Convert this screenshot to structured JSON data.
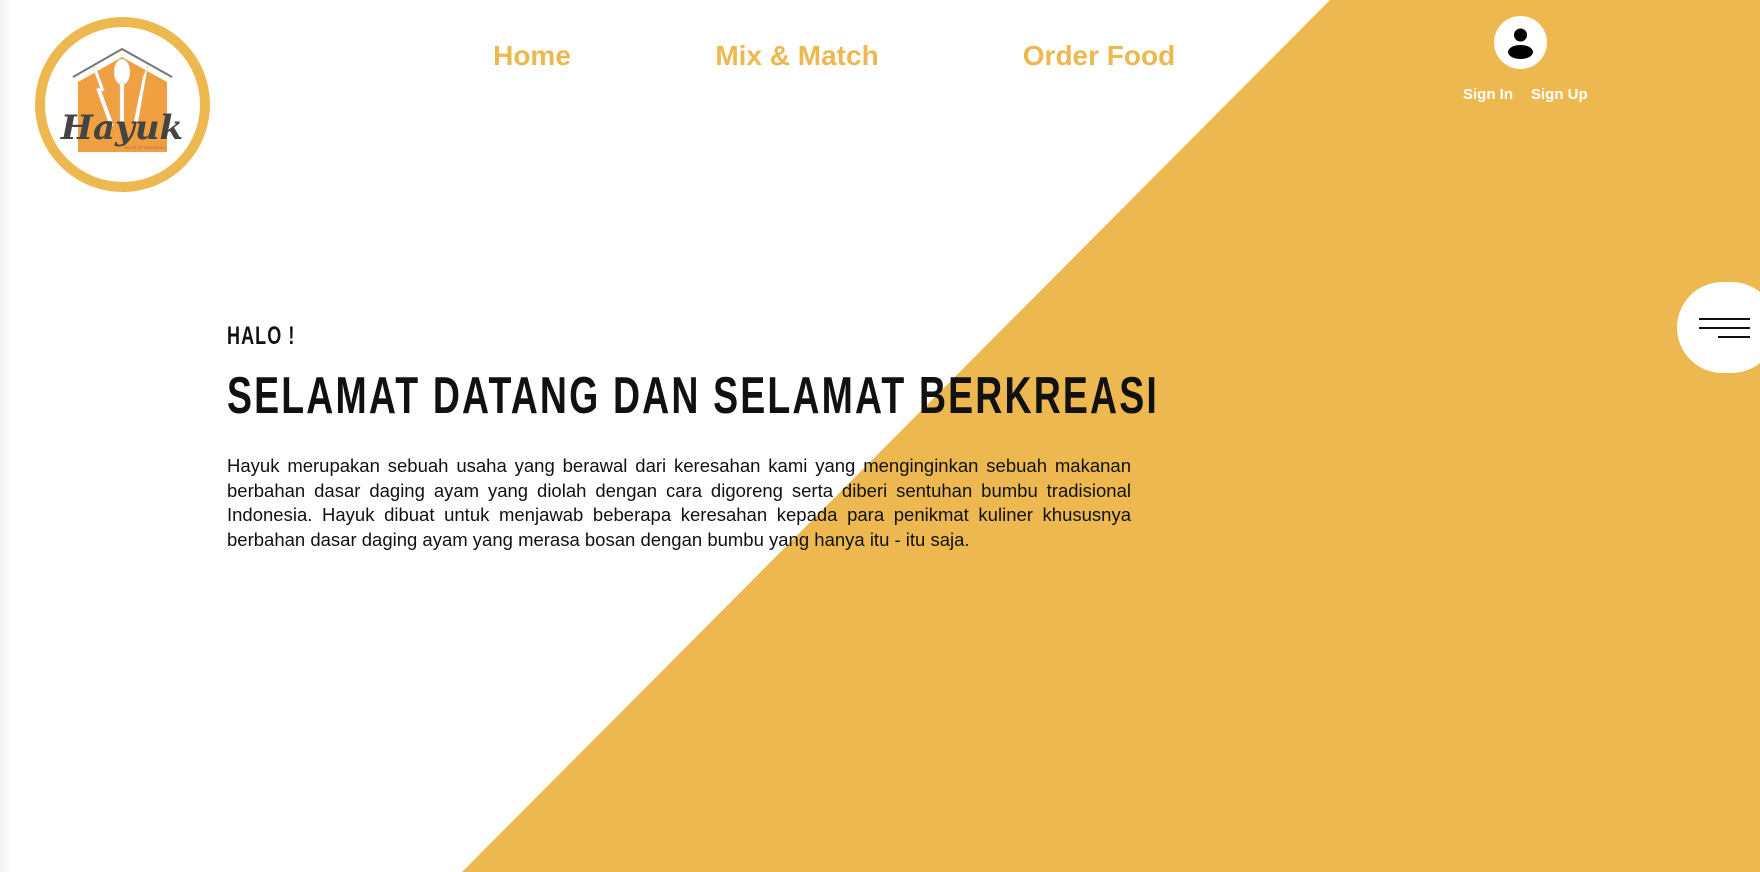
{
  "logo": {
    "text": "Hayuk",
    "tagline": "TASTE OF INDONESIA"
  },
  "nav": {
    "items": [
      {
        "label": "Home"
      },
      {
        "label": "Mix & Match"
      },
      {
        "label": "Order Food"
      }
    ]
  },
  "account": {
    "icon": "user-icon",
    "sign_in": "Sign In",
    "sign_up": "Sign Up"
  },
  "menu": {
    "icon": "hamburger-menu-icon"
  },
  "hero": {
    "greeting": "HALO !",
    "title": "SELAMAT DATANG DAN SELAMAT BERKREASI",
    "description": "Hayuk merupakan sebuah usaha yang berawal dari keresahan kami yang menginginkan sebuah makanan berbahan dasar daging ayam yang diolah dengan cara digoreng serta diberi sentuhan bumbu tradisional Indonesia. Hayuk dibuat untuk menjawab beberapa keresahan kepada para penikmat kuliner khususnya berbahan dasar daging ayam yang merasa bosan dengan bumbu yang hanya itu - itu saja."
  },
  "colors": {
    "accent": "#EDB84F",
    "logo_orange": "#F0A040",
    "text": "#111111"
  }
}
